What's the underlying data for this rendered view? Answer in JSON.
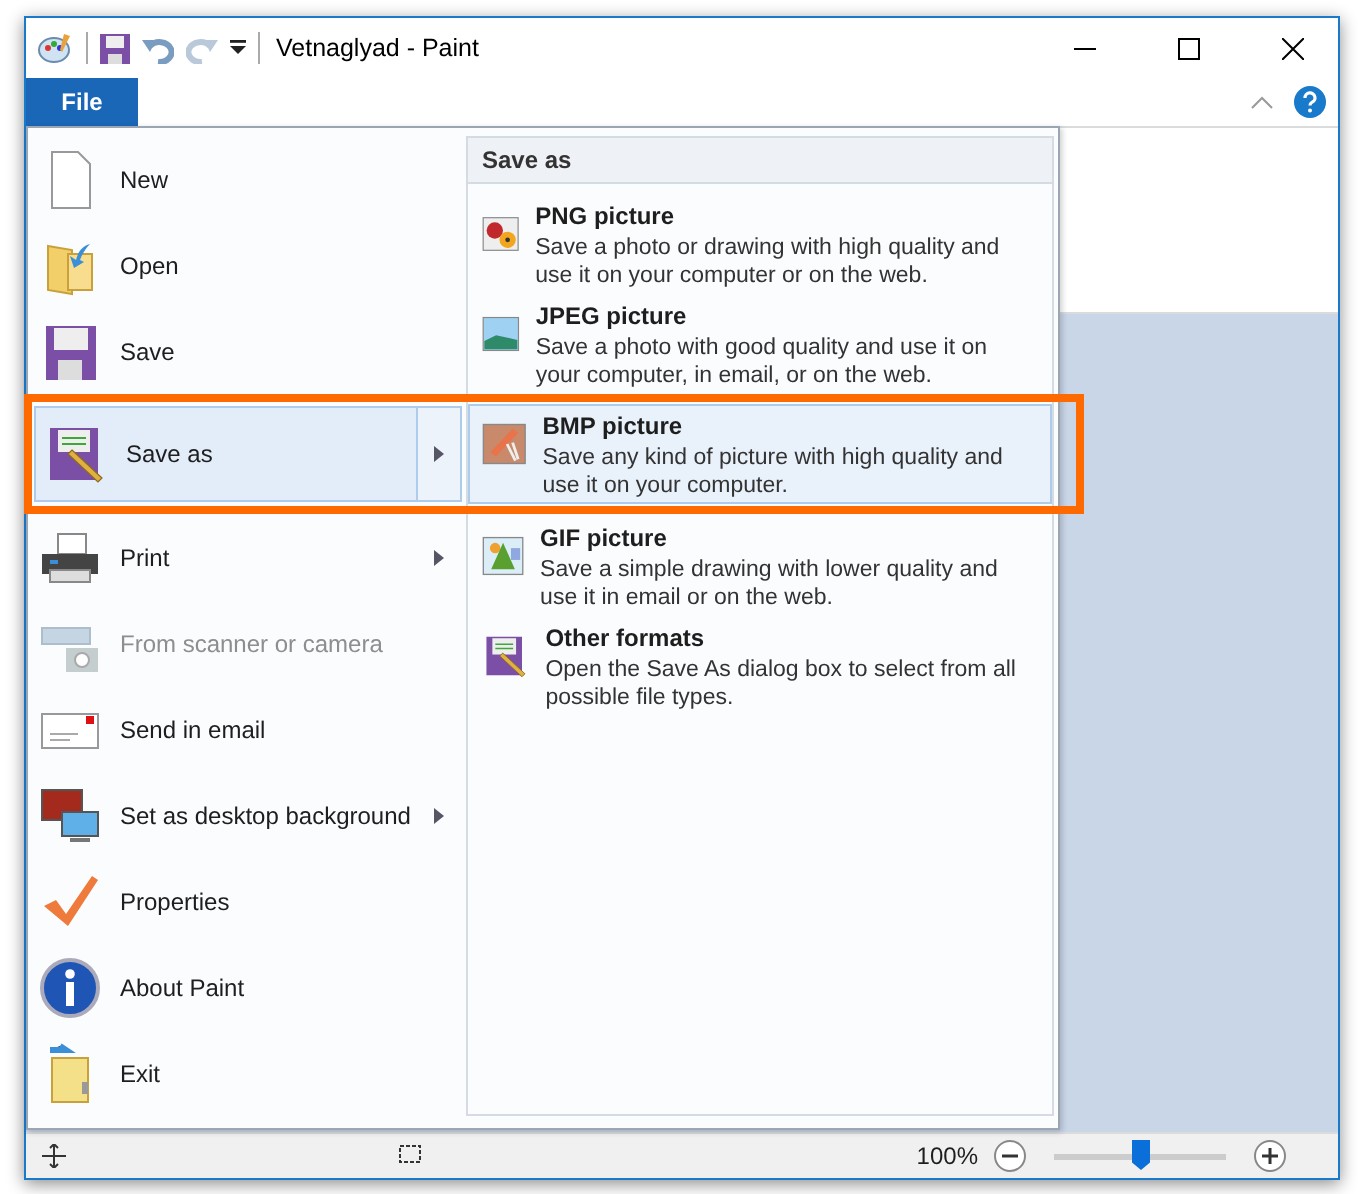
{
  "window": {
    "title": "Vetnaglyad - Paint"
  },
  "file_tab": {
    "label": "File",
    "selected": true
  },
  "file_menu": {
    "items": [
      {
        "kind": "new",
        "label": "New",
        "submenu": false,
        "selected": false,
        "disabled": false
      },
      {
        "kind": "open",
        "label": "Open",
        "submenu": false,
        "selected": false,
        "disabled": false
      },
      {
        "kind": "save",
        "label": "Save",
        "submenu": false,
        "selected": false,
        "disabled": false
      },
      {
        "kind": "saveas",
        "label": "Save as",
        "submenu": true,
        "selected": true,
        "disabled": false,
        "highlighted": true
      },
      {
        "kind": "print",
        "label": "Print",
        "submenu": true,
        "selected": false,
        "disabled": false
      },
      {
        "kind": "scanner",
        "label": "From scanner or camera",
        "submenu": false,
        "selected": false,
        "disabled": true
      },
      {
        "kind": "email",
        "label": "Send in email",
        "submenu": false,
        "selected": false,
        "disabled": false
      },
      {
        "kind": "desktop",
        "label": "Set as desktop background",
        "submenu": true,
        "selected": false,
        "disabled": false
      },
      {
        "kind": "properties",
        "label": "Properties",
        "submenu": false,
        "selected": false,
        "disabled": false
      },
      {
        "kind": "about",
        "label": "About Paint",
        "submenu": false,
        "selected": false,
        "disabled": false
      },
      {
        "kind": "exit",
        "label": "Exit",
        "submenu": false,
        "selected": false,
        "disabled": false
      }
    ]
  },
  "save_as_panel": {
    "title": "Save as",
    "items": [
      {
        "kind": "png",
        "title": "PNG picture",
        "description": "Save a photo or drawing with high quality and use it on your computer or on the web.",
        "selected": false
      },
      {
        "kind": "jpeg",
        "title": "JPEG picture",
        "description": "Save a photo with good quality and use it on your computer, in email, or on the web.",
        "selected": false
      },
      {
        "kind": "bmp",
        "title": "BMP picture",
        "description": "Save any kind of picture with high quality and use it on your computer.",
        "selected": true
      },
      {
        "kind": "gif",
        "title": "GIF picture",
        "description": "Save a simple drawing with lower quality and use it in email or on the web.",
        "selected": false
      },
      {
        "kind": "other",
        "title": "Other formats",
        "description": "Open the Save As dialog box to select from all possible file types.",
        "selected": false
      }
    ]
  },
  "status_bar": {
    "zoom": "100%",
    "zoom_slider": {
      "level": 0.5
    }
  }
}
